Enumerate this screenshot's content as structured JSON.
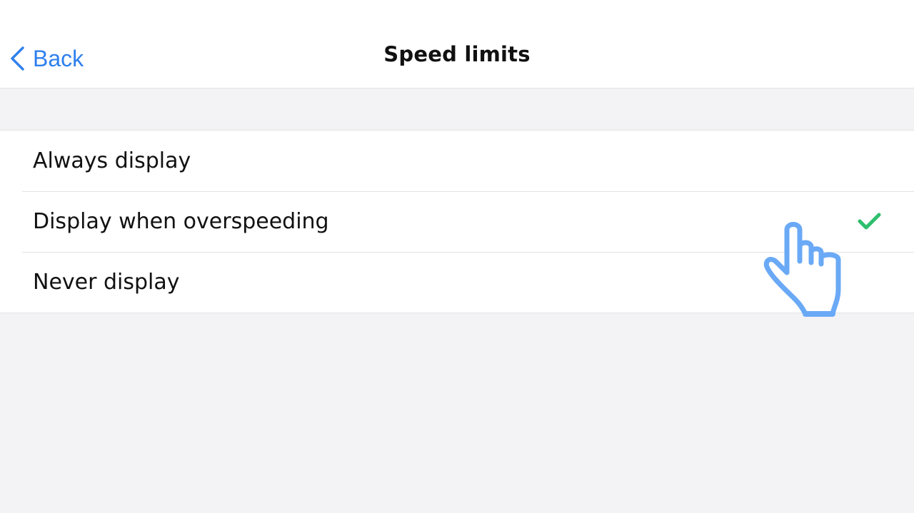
{
  "header": {
    "back_label": "Back",
    "title": "Speed limits"
  },
  "options": [
    {
      "label": "Always display",
      "selected": false
    },
    {
      "label": "Display when overspeeding",
      "selected": true
    },
    {
      "label": "Never display",
      "selected": false
    }
  ],
  "icons": {
    "back": "chevron-left-icon",
    "selected": "checkmark-icon",
    "pointer": "pointing-hand-icon"
  },
  "colors": {
    "accent": "#2f80ed",
    "check": "#2dbf6c",
    "pointer": "#6aa9f6",
    "background": "#f3f3f5"
  }
}
